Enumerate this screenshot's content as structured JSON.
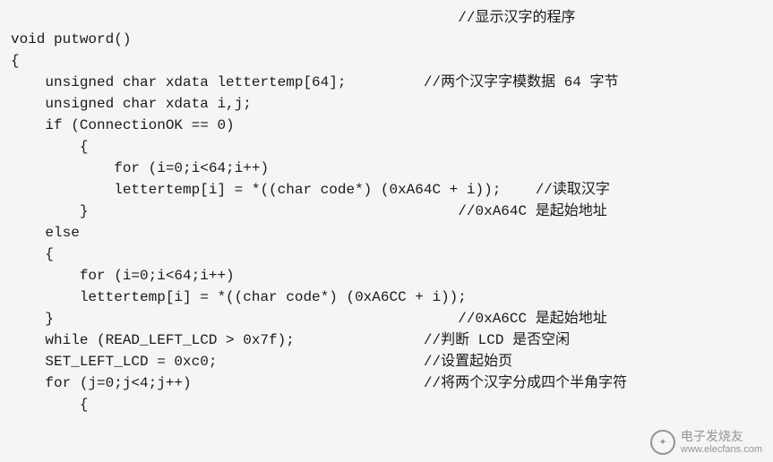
{
  "code": {
    "lines": [
      {
        "indent": 0,
        "text": "",
        "comment": "//显示汉字的程序",
        "commentCol": 52
      },
      {
        "indent": 0,
        "text": "void putword()",
        "comment": "",
        "commentCol": 0
      },
      {
        "indent": 0,
        "text": "{",
        "comment": "",
        "commentCol": 0
      },
      {
        "indent": 4,
        "text": "unsigned char xdata lettertemp[64];",
        "comment": "//两个汉字字模数据 64 字节",
        "commentCol": 48
      },
      {
        "indent": 4,
        "text": "unsigned char xdata i,j;",
        "comment": "",
        "commentCol": 0
      },
      {
        "indent": 4,
        "text": "if (ConnectionOK == 0)",
        "comment": "",
        "commentCol": 0
      },
      {
        "indent": 8,
        "text": "{",
        "comment": "",
        "commentCol": 0
      },
      {
        "indent": 12,
        "text": "for (i=0;i<64;i++)",
        "comment": "",
        "commentCol": 0
      },
      {
        "indent": 12,
        "text": "lettertemp[i] = *((char code*) (0xA64C + i));",
        "comment": "//读取汉字",
        "commentCol": 61
      },
      {
        "indent": 8,
        "text": "}",
        "comment": "//0xA64C 是起始地址",
        "commentCol": 52
      },
      {
        "indent": 4,
        "text": "else",
        "comment": "",
        "commentCol": 0
      },
      {
        "indent": 4,
        "text": "{",
        "comment": "",
        "commentCol": 0
      },
      {
        "indent": 8,
        "text": "for (i=0;i<64;i++)",
        "comment": "",
        "commentCol": 0
      },
      {
        "indent": 8,
        "text": "lettertemp[i] = *((char code*) (0xA6CC + i));",
        "comment": "",
        "commentCol": 0
      },
      {
        "indent": 4,
        "text": "}",
        "comment": "//0xA6CC 是起始地址",
        "commentCol": 52
      },
      {
        "indent": 4,
        "text": "while (READ_LEFT_LCD > 0x7f);",
        "comment": "//判断 LCD 是否空闲",
        "commentCol": 48
      },
      {
        "indent": 4,
        "text": "SET_LEFT_LCD = 0xc0;",
        "comment": "//设置起始页",
        "commentCol": 48
      },
      {
        "indent": 4,
        "text": "for (j=0;j<4;j++)",
        "comment": "//将两个汉字分成四个半角字符",
        "commentCol": 48
      },
      {
        "indent": 8,
        "text": "{",
        "comment": "",
        "commentCol": 0
      }
    ]
  },
  "watermark": {
    "iconGlyph": "✦",
    "brandCn": "电子发烧友",
    "brandUrl": "www.elecfans.com"
  }
}
